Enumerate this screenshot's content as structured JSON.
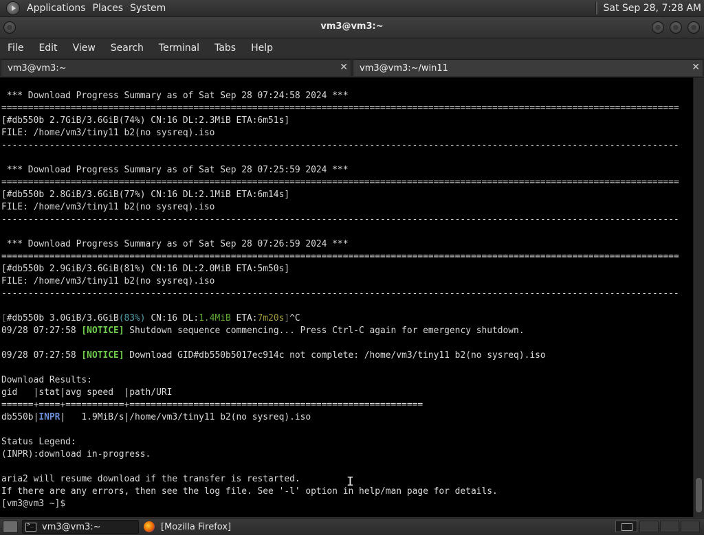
{
  "top_panel": {
    "menus": [
      "Applications",
      "Places",
      "System"
    ],
    "clock": "Sat Sep 28,  7:28 AM"
  },
  "window": {
    "title": "vm3@vm3:~"
  },
  "menubar": [
    "File",
    "Edit",
    "View",
    "Search",
    "Terminal",
    "Tabs",
    "Help"
  ],
  "tabs": [
    {
      "label": "vm3@vm3:~",
      "close": "✕"
    },
    {
      "label": "vm3@vm3:~/win11",
      "close": "✕"
    }
  ],
  "terminal": {
    "lines": [
      [
        {
          "t": " *** Download Progress Summary as of Sat Sep 28 07:24:58 2024 ***"
        }
      ],
      [
        {
          "t": "==============================================================================================================================="
        }
      ],
      [
        {
          "t": "[#db550b 2.7GiB/3.6GiB(74%) CN:16 DL:2.3MiB ETA:6m51s]"
        }
      ],
      [
        {
          "t": "FILE: /home/vm3/tiny11 b2(no sysreq).iso"
        }
      ],
      [
        {
          "t": "-------------------------------------------------------------------------------------------------------------------------------"
        }
      ],
      [
        {
          "t": ""
        }
      ],
      [
        {
          "t": " *** Download Progress Summary as of Sat Sep 28 07:25:59 2024 ***"
        }
      ],
      [
        {
          "t": "==============================================================================================================================="
        }
      ],
      [
        {
          "t": "[#db550b 2.8GiB/3.6GiB(77%) CN:16 DL:2.1MiB ETA:6m14s]"
        }
      ],
      [
        {
          "t": "FILE: /home/vm3/tiny11 b2(no sysreq).iso"
        }
      ],
      [
        {
          "t": "-------------------------------------------------------------------------------------------------------------------------------"
        }
      ],
      [
        {
          "t": ""
        }
      ],
      [
        {
          "t": " *** Download Progress Summary as of Sat Sep 28 07:26:59 2024 ***"
        }
      ],
      [
        {
          "t": "==============================================================================================================================="
        }
      ],
      [
        {
          "t": "[#db550b 2.9GiB/3.6GiB(81%) CN:16 DL:2.0MiB ETA:5m50s]"
        }
      ],
      [
        {
          "t": "FILE: /home/vm3/tiny11 b2(no sysreq).iso"
        }
      ],
      [
        {
          "t": "-------------------------------------------------------------------------------------------------------------------------------"
        }
      ],
      [
        {
          "t": ""
        }
      ],
      [
        {
          "t": "[",
          "c": "c-dim"
        },
        {
          "t": "#db550b 3.0GiB/3.6GiB"
        },
        {
          "t": "(83%)",
          "c": "c-cyan"
        },
        {
          "t": " CN:16 DL:"
        },
        {
          "t": "1.4MiB",
          "c": "c-green"
        },
        {
          "t": " ETA:"
        },
        {
          "t": "7m20s",
          "c": "c-olive"
        },
        {
          "t": "]",
          "c": "c-dim"
        },
        {
          "t": "^C"
        }
      ],
      [
        {
          "t": "09/28 07:27:58 "
        },
        {
          "t": "[NOTICE]",
          "c": "c-notice"
        },
        {
          "t": " Shutdown sequence commencing... Press Ctrl-C again for emergency shutdown."
        }
      ],
      [
        {
          "t": ""
        }
      ],
      [
        {
          "t": "09/28 07:27:58 "
        },
        {
          "t": "[NOTICE]",
          "c": "c-notice"
        },
        {
          "t": " Download GID#db550b5017ec914c not complete: /home/vm3/tiny11 b2(no sysreq).iso"
        }
      ],
      [
        {
          "t": ""
        }
      ],
      [
        {
          "t": "Download Results:"
        }
      ],
      [
        {
          "t": "gid   |stat|avg speed  |path/URI"
        }
      ],
      [
        {
          "t": "======+====+===========+======================================================="
        }
      ],
      [
        {
          "t": "db550b|"
        },
        {
          "t": "INPR",
          "c": "c-inpr"
        },
        {
          "t": "|   1.9MiB/s|/home/vm3/tiny11 b2(no sysreq).iso"
        }
      ],
      [
        {
          "t": ""
        }
      ],
      [
        {
          "t": "Status Legend:"
        }
      ],
      [
        {
          "t": "(INPR):download in-progress."
        }
      ],
      [
        {
          "t": ""
        }
      ],
      [
        {
          "t": "aria2 will resume download if the transfer is restarted."
        }
      ],
      [
        {
          "t": "If there are any errors, then see the log file. See '-l' option in help/man page for details."
        }
      ],
      [
        {
          "t": "[vm3@vm3 ~]$ "
        }
      ]
    ]
  },
  "taskbar": {
    "items": [
      {
        "label": "vm3@vm3:~",
        "icon": "terminal-icon"
      },
      {
        "label": "[Mozilla Firefox]",
        "icon": "firefox-icon"
      }
    ]
  },
  "icons": {
    "text_cursor": "I"
  }
}
